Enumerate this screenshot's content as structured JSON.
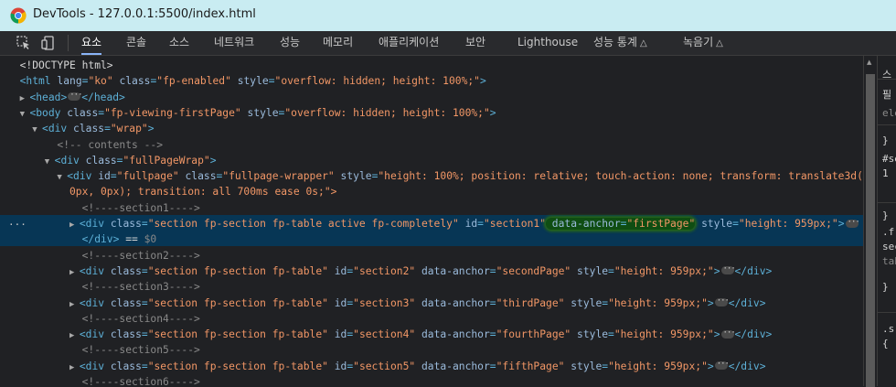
{
  "window": {
    "title": "DevTools - 127.0.0.1:5500/index.html"
  },
  "toolbar": {
    "tabs": [
      "요소",
      "콘솔",
      "소스",
      "네트워크",
      "성능",
      "메모리",
      "애플리케이션",
      "보안",
      "Lighthouse",
      "성능 통계",
      "녹음기"
    ],
    "active_tab": "요소"
  },
  "elements": {
    "doctype": "<!DOCTYPE html>",
    "html_open": {
      "tag": "html",
      "attrs": [
        [
          "lang",
          "ko"
        ],
        [
          "class",
          "fp-enabled"
        ],
        [
          "style",
          "overflow: hidden; height: 100%;"
        ]
      ]
    },
    "head": "head",
    "body_open": {
      "tag": "body",
      "attrs": [
        [
          "class",
          "fp-viewing-firstPage"
        ],
        [
          "style",
          "overflow: hidden; height: 100%;"
        ]
      ]
    },
    "wrap": {
      "tag": "div",
      "attrs": [
        [
          "class",
          "wrap"
        ]
      ]
    },
    "comment_contents": " contents ",
    "fullPageWrap": {
      "tag": "div",
      "attrs": [
        [
          "class",
          "fullPageWrap"
        ]
      ]
    },
    "fullpage_line1": {
      "tag": "div",
      "attrs": [
        [
          "id",
          "fullpage"
        ],
        [
          "class",
          "fullpage-wrapper"
        ],
        [
          "style",
          "height: 100%; position: relative; touch-action: none; transform: translate3d(0px,"
        ]
      ]
    },
    "fullpage_line2": "0px, 0px); transition: all 700ms ease 0s;\">",
    "selected_indicator": "...",
    "selected_suffix": "</div> == $0",
    "sections": [
      {
        "comment": "--section1--",
        "id": "section1",
        "anchor": "firstPage",
        "selected": true
      },
      {
        "comment": "--section2--",
        "id": "section2",
        "anchor": "secondPage",
        "selected": false
      },
      {
        "comment": "--section3--",
        "id": "section3",
        "anchor": "thirdPage",
        "selected": false
      },
      {
        "comment": "--section4--",
        "id": "section4",
        "anchor": "fourthPage",
        "selected": false
      },
      {
        "comment": "--section5--",
        "id": "section5",
        "anchor": "fifthPage",
        "selected": false
      },
      {
        "comment": "--section6--"
      }
    ],
    "section_class_selected": "section fp-section fp-table active fp-completely",
    "section_class": "section fp-section fp-table",
    "section_style": "height: 959px;"
  },
  "styles_pane": {
    "lines": [
      "스",
      "필",
      "ele",
      "}",
      "#se",
      "1",
      "}",
      ".f",
      "sec",
      "tab",
      "}",
      ".s",
      "{"
    ]
  },
  "colors": {
    "tag": "#5db0d7",
    "attr_name": "#9bbbdc",
    "attr_value": "#f29766",
    "comment": "#898989",
    "selected_bg": "#073655",
    "titlebar_bg": "#c9ecf2"
  }
}
